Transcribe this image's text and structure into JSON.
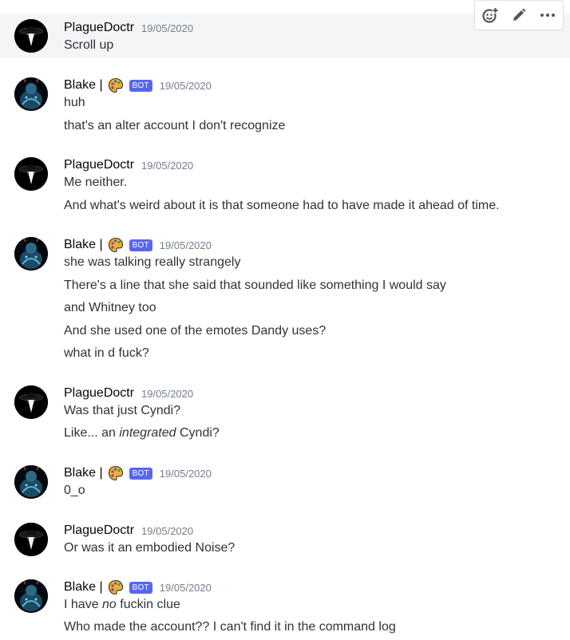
{
  "users": {
    "plague": {
      "name": "PlagueDoctr"
    },
    "blake": {
      "name": "Blake |",
      "bot_tag": "BOT"
    }
  },
  "messages": [
    {
      "author": "PlagueDoctr",
      "timestamp": "19/05/2020",
      "lines": [
        "Scroll up"
      ]
    },
    {
      "author": "Blake |",
      "timestamp": "19/05/2020",
      "lines": [
        "huh",
        "that's an alter account I don't recognize"
      ]
    },
    {
      "author": "PlagueDoctr",
      "timestamp": "19/05/2020",
      "lines": [
        "Me neither.",
        "And what's weird about it is that someone had to have made it ahead of time."
      ]
    },
    {
      "author": "Blake |",
      "timestamp": "19/05/2020",
      "lines": [
        "she was talking really strangely",
        "There's a line that she said that sounded like something I would say",
        "and Whitney too",
        "And she used one of the emotes Dandy uses?",
        "what in d fuck?"
      ]
    },
    {
      "author": "PlagueDoctr",
      "timestamp": "19/05/2020",
      "lines": [
        "Was that just Cyndi?"
      ],
      "rich_line": {
        "before": "Like... an ",
        "italic": "integrated",
        "after": " Cyndi?"
      }
    },
    {
      "author": "Blake |",
      "timestamp": "19/05/2020",
      "lines": [
        "0_o"
      ]
    },
    {
      "author": "PlagueDoctr",
      "timestamp": "19/05/2020",
      "lines": [
        "Or was it an embodied Noise?"
      ]
    },
    {
      "author": "Blake |",
      "timestamp": "19/05/2020",
      "rich_line": {
        "before": "I have ",
        "italic": "no",
        "after": " fuckin clue"
      },
      "lines": [
        "Who made the account?? I can't find it in the command log"
      ]
    }
  ],
  "toolbar": {
    "icons": [
      "add-reaction-icon",
      "edit-icon",
      "more-icon"
    ]
  },
  "colors": {
    "bot_badge": "#5865f2",
    "hover_bg": "#f4f5f7",
    "timestamp": "#747f8d"
  }
}
